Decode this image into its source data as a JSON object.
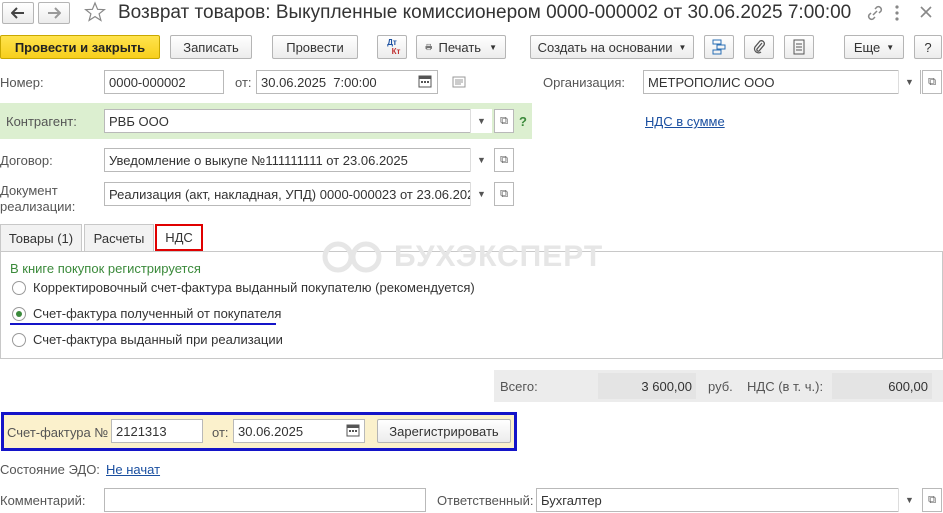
{
  "window": {
    "title": "Возврат товаров: Выкупленные комиссионером 0000-000002 от 30.06.2025 7:00:00"
  },
  "toolbar": {
    "post_close": "Провести и закрыть",
    "save": "Записать",
    "post": "Провести",
    "dtkt_top": "Дт",
    "dtkt_bottom": "Кт",
    "print": "Печать",
    "create_based": "Создать на основании",
    "more": "Еще",
    "help": "?"
  },
  "header": {
    "number_label": "Номер:",
    "number": "0000-000002",
    "from_label": "от:",
    "date": "30.06.2025  7:00:00",
    "org_label": "Организация:",
    "org": "МЕТРОПОЛИС ООО",
    "counterparty_label": "Контрагент:",
    "counterparty": "РВБ ООО",
    "vat_link": "НДС в сумме",
    "contract_label": "Договор:",
    "contract": "Уведомление о выкупе №111111111 от 23.06.2025",
    "sale_doc_label_1": "Документ",
    "sale_doc_label_2": "реализации:",
    "sale_doc": "Реализация (акт, накладная, УПД) 0000-000023 от 23.06.202"
  },
  "tabs": [
    {
      "label": "Товары (1)"
    },
    {
      "label": "Расчеты"
    },
    {
      "label": "НДС"
    }
  ],
  "vat_panel": {
    "heading": "В книге покупок регистрируется",
    "options": [
      {
        "label": "Корректировочный счет-фактура выданный покупателю (рекомендуется)",
        "selected": false
      },
      {
        "label": "Счет-фактура полученный от покупателя",
        "selected": true
      },
      {
        "label": "Счет-фактура выданный при реализации",
        "selected": false
      }
    ]
  },
  "watermark": "БУХЭКСПЕРТ",
  "totals": {
    "total_label": "Всего:",
    "total": "3 600,00",
    "currency": "руб.",
    "vat_label": "НДС (в т. ч.):",
    "vat": "600,00"
  },
  "invoice": {
    "label": "Счет-фактура №",
    "number": "2121313",
    "from_label": "от:",
    "date": "30.06.2025",
    "register": "Зарегистрировать"
  },
  "edo": {
    "label": "Состояние ЭДО:",
    "status": "Не начат"
  },
  "footer": {
    "comment_label": "Комментарий:",
    "comment": "",
    "responsible_label": "Ответственный:",
    "responsible": "Бухгалтер"
  },
  "colors": {
    "primary": "#f7cf1c",
    "green": "#3b8a3b",
    "link": "#1a4fa0",
    "highlight_red": "#e00000",
    "highlight_blue": "#1414c8"
  }
}
